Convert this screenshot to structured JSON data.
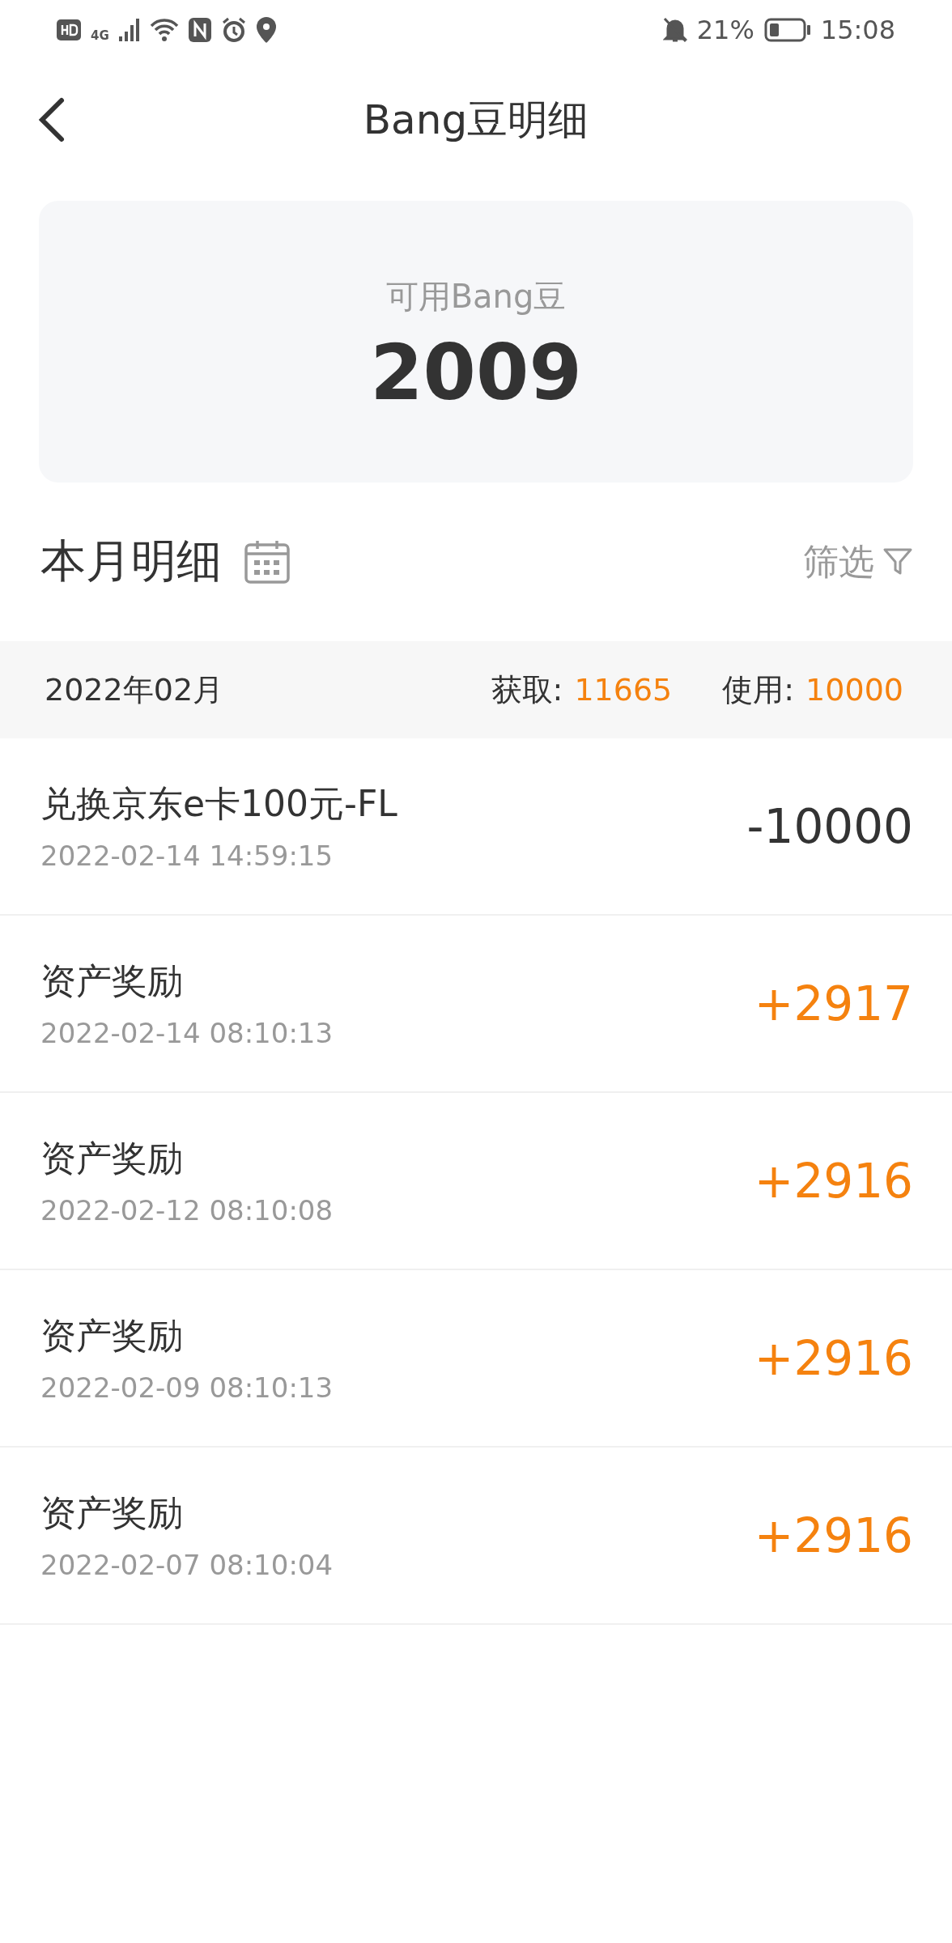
{
  "status_bar": {
    "network": "4G",
    "battery_percent": "21%",
    "time": "15:08"
  },
  "header": {
    "title": "Bang豆明细"
  },
  "balance": {
    "label": "可用Bang豆",
    "value": "2009"
  },
  "section": {
    "title": "本月明细",
    "filter": "筛选"
  },
  "month": {
    "label": "2022年02月",
    "earned_label": "获取:",
    "earned": "11665",
    "used_label": "使用:",
    "used": "10000"
  },
  "records": [
    {
      "title": "兑换京东e卡100元-FL",
      "time": "2022-02-14 14:59:15",
      "amount": "-10000",
      "kind": "spend"
    },
    {
      "title": "资产奖励",
      "time": "2022-02-14 08:10:13",
      "amount": "+2917",
      "kind": "earn"
    },
    {
      "title": "资产奖励",
      "time": "2022-02-12 08:10:08",
      "amount": "+2916",
      "kind": "earn"
    },
    {
      "title": "资产奖励",
      "time": "2022-02-09 08:10:13",
      "amount": "+2916",
      "kind": "earn"
    },
    {
      "title": "资产奖励",
      "time": "2022-02-07 08:10:04",
      "amount": "+2916",
      "kind": "earn"
    }
  ]
}
